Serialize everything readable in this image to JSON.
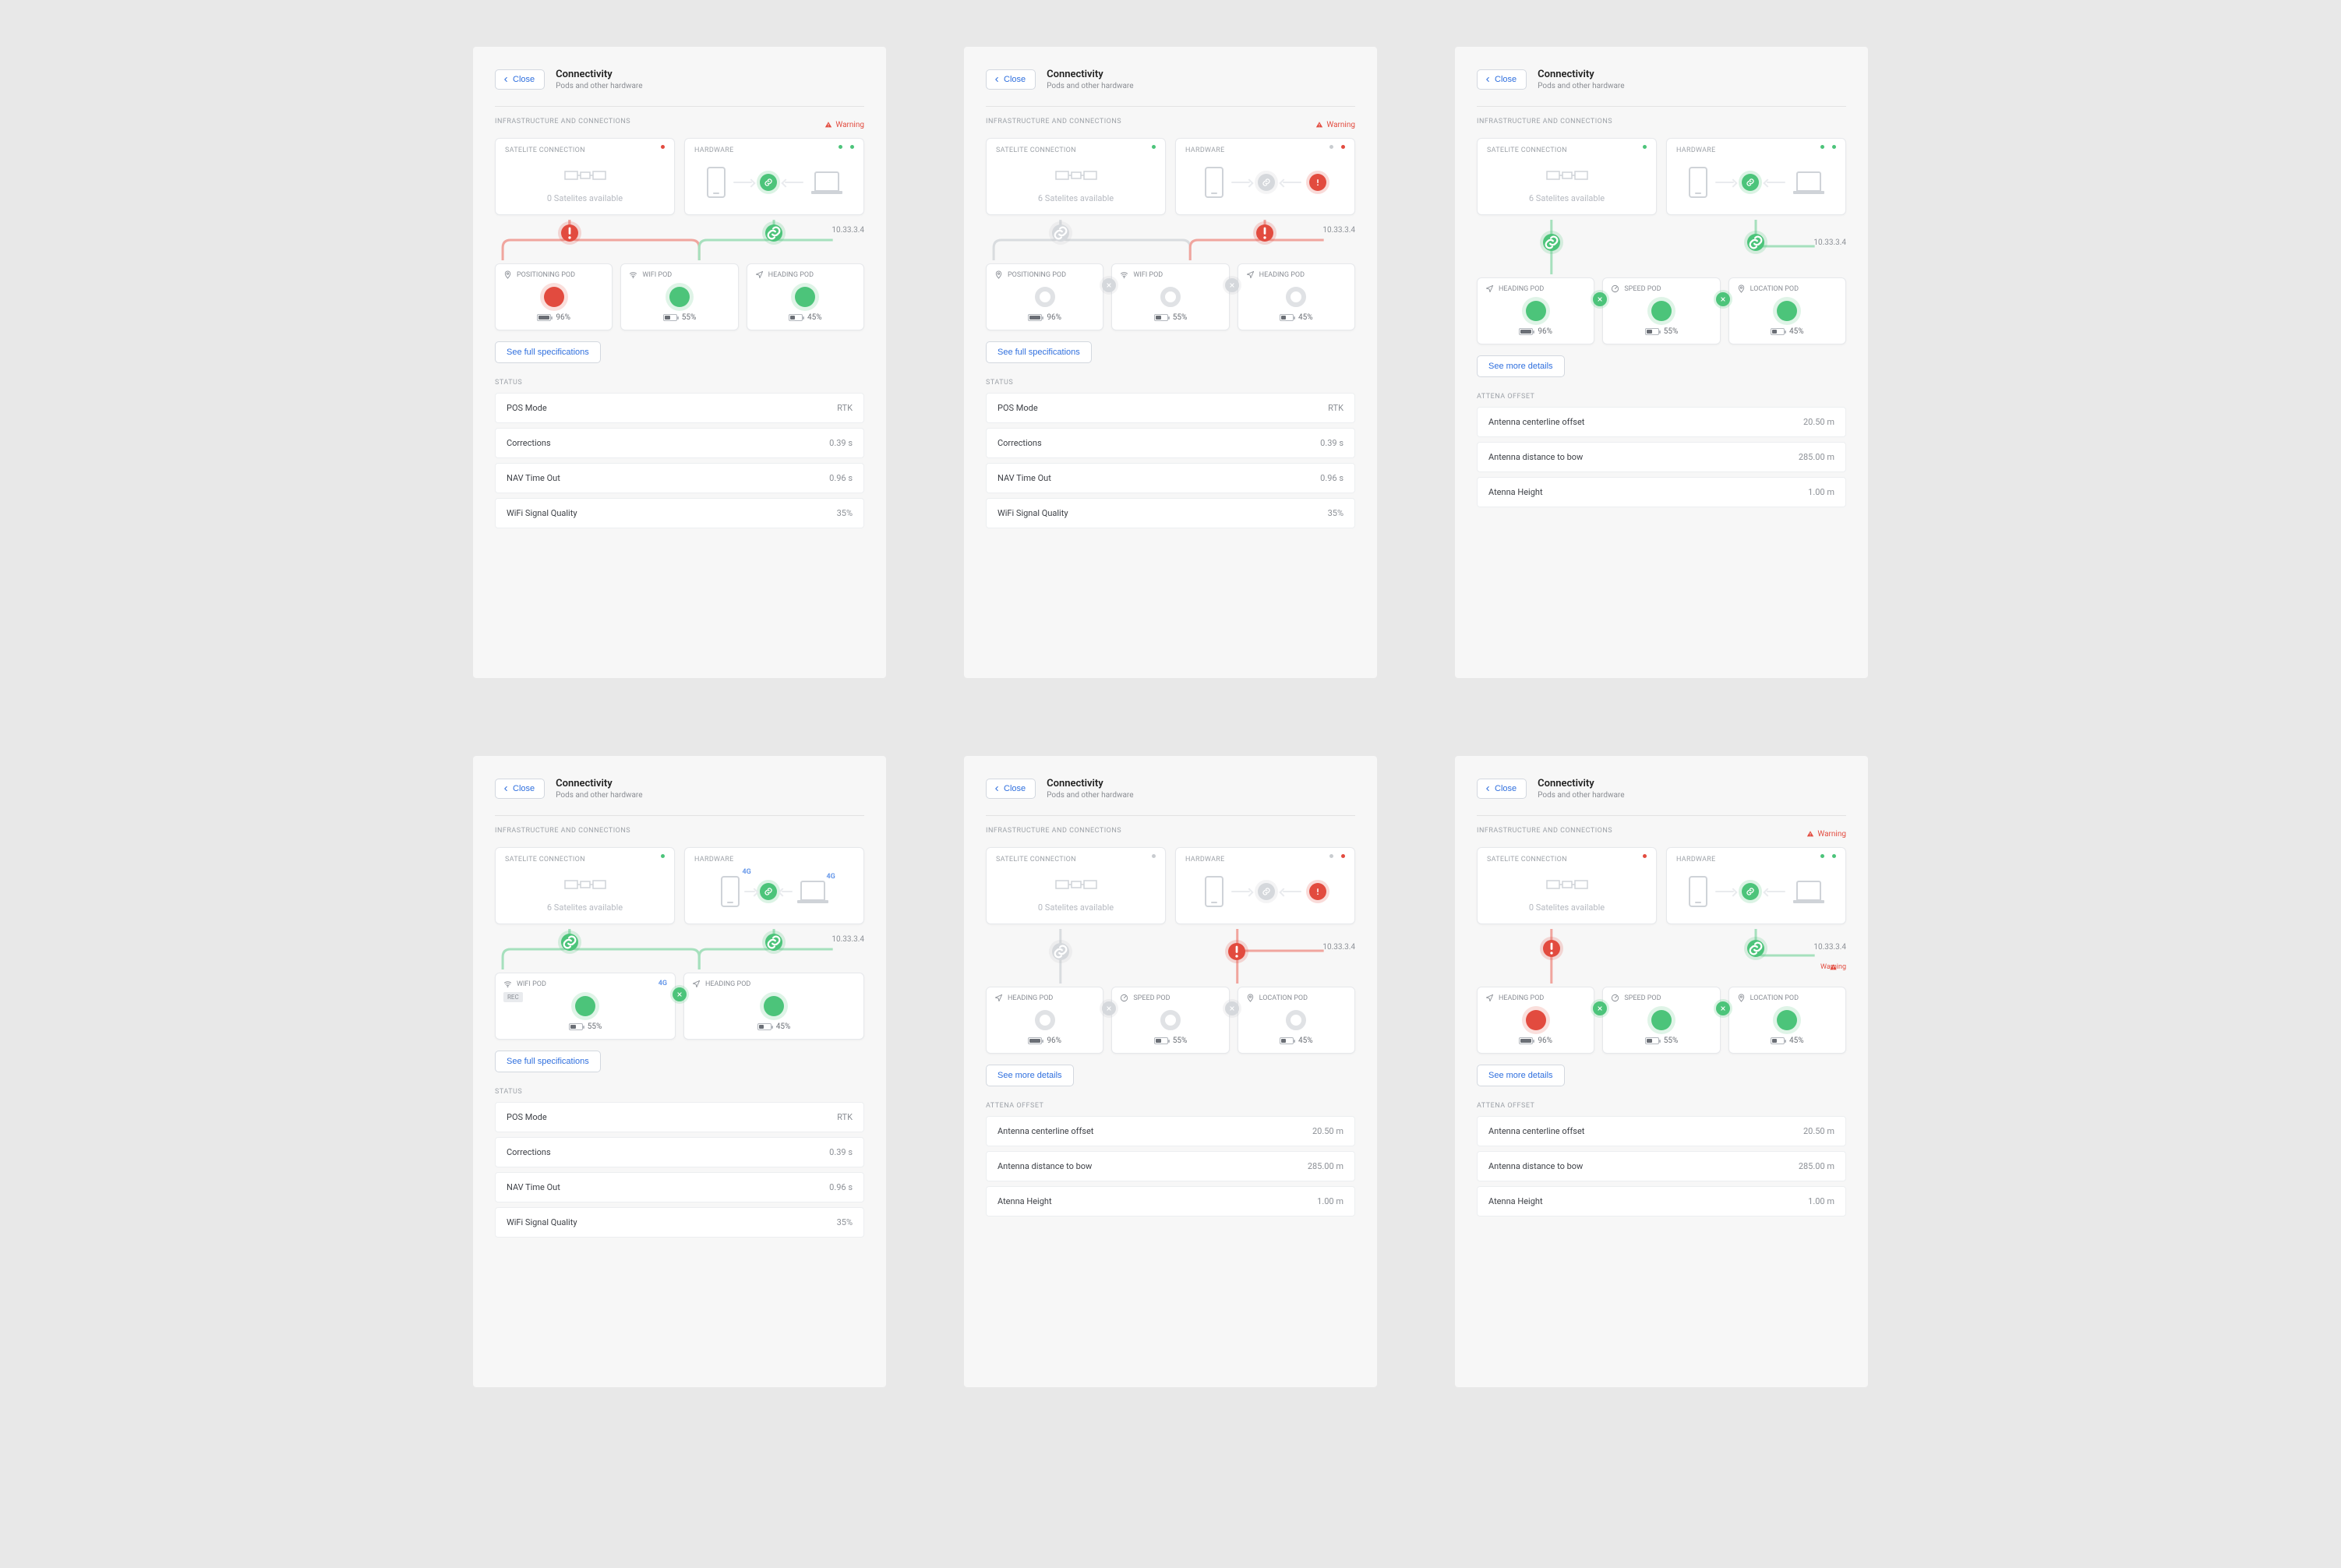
{
  "common": {
    "close": "Close",
    "title": "Connectivity",
    "subtitle": "Pods and other hardware",
    "infra_label": "INFRASTRUCTURE AND CONNECTIONS",
    "warning": "Warning",
    "sat_card": "SATELITE CONNECTION",
    "hw_card": "HARDWARE",
    "ip": "10.33.3.4",
    "see_specs": "See full specifications",
    "see_details": "See more details",
    "status_label": "STATUS",
    "antenna_label": "ATTENA OFFSET",
    "badge_4g": "4G",
    "badge_rec": "REC"
  },
  "pods": {
    "positioning": "POSITIONING POD",
    "wifi": "WIFI POD",
    "heading": "HEADING POD",
    "speed": "SPEED POD",
    "location": "LOCATION POD"
  },
  "batt": {
    "p96": "96%",
    "p55": "55%",
    "p45": "45%"
  },
  "sat": {
    "six": "6 Satelites available",
    "zero": "0 Satelites available"
  },
  "status_rows": [
    {
      "label": "POS Mode",
      "value": "RTK"
    },
    {
      "label": "Corrections",
      "value": "0.39 s"
    },
    {
      "label": "NAV Time Out",
      "value": "0.96 s"
    },
    {
      "label": "WiFi Signal Quality",
      "value": "35%"
    }
  ],
  "antenna_rows": [
    {
      "label": "Antenna centerline offset",
      "value": "20.50 m"
    },
    {
      "label": "Antenna distance to bow",
      "value": "285.00 m"
    },
    {
      "label": "Atenna Height",
      "value": "1.00 m"
    }
  ]
}
